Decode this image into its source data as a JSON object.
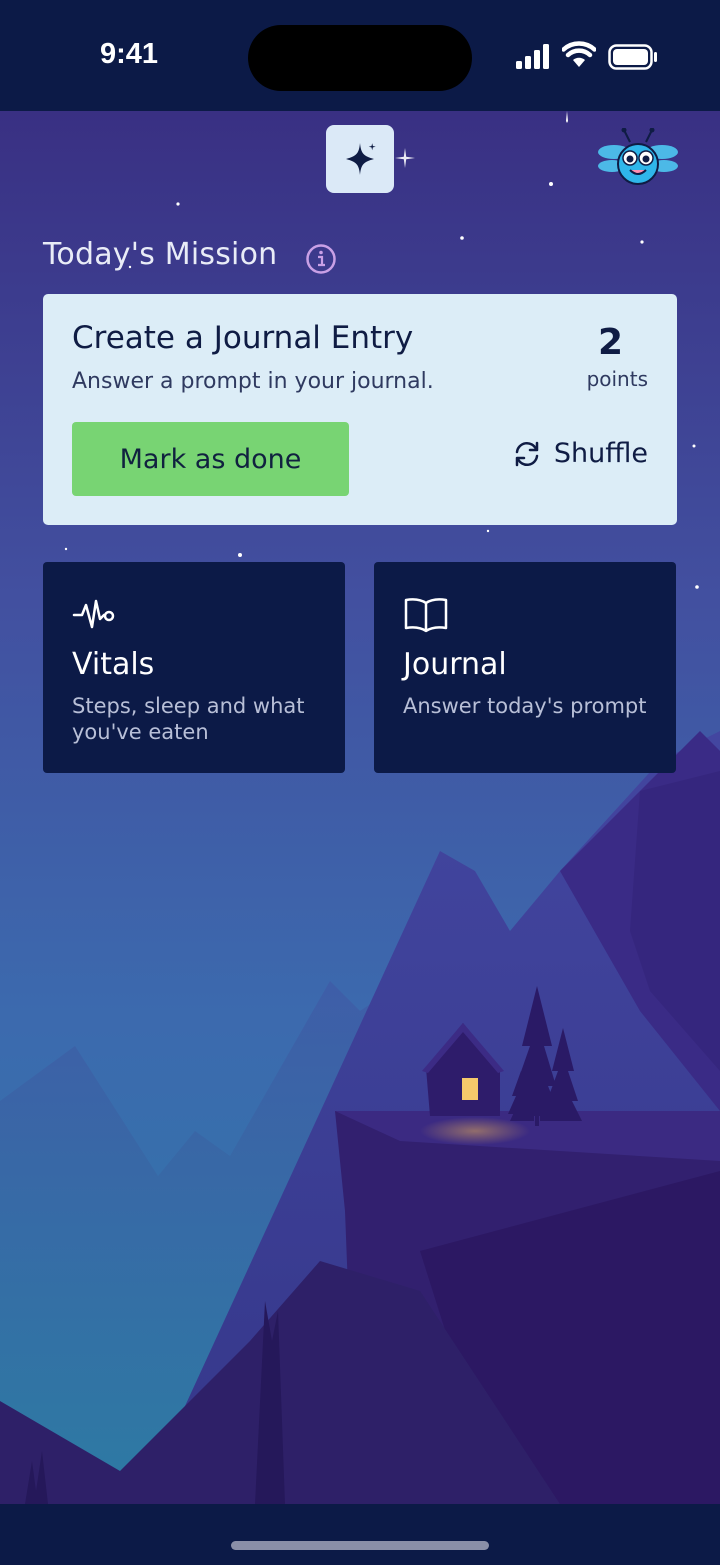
{
  "status_bar": {
    "time": "9:41"
  },
  "header": {
    "sparkle_icon": "sparkle-icon",
    "mascot_icon": "dragonfly-mascot-icon"
  },
  "mission_section": {
    "title": "Today's Mission",
    "info_icon": "info-icon"
  },
  "mission_card": {
    "title": "Create a Journal Entry",
    "subtitle": "Answer a prompt in your journal.",
    "points_value": "2",
    "points_label": "points",
    "done_label": "Mark as done",
    "shuffle_label": "Shuffle",
    "done_color": "#78d473"
  },
  "tiles": [
    {
      "title": "Vitals",
      "description": "Steps, sleep and what you've eaten",
      "icon": "heartbeat-icon"
    },
    {
      "title": "Journal",
      "description": "Answer today's prompt",
      "icon": "open-book-icon"
    }
  ],
  "colors": {
    "navy": "#0c1a47",
    "card_bg": "#dcedf7",
    "sky_top": "#3a3486",
    "sky_bottom": "#3a6db0"
  }
}
